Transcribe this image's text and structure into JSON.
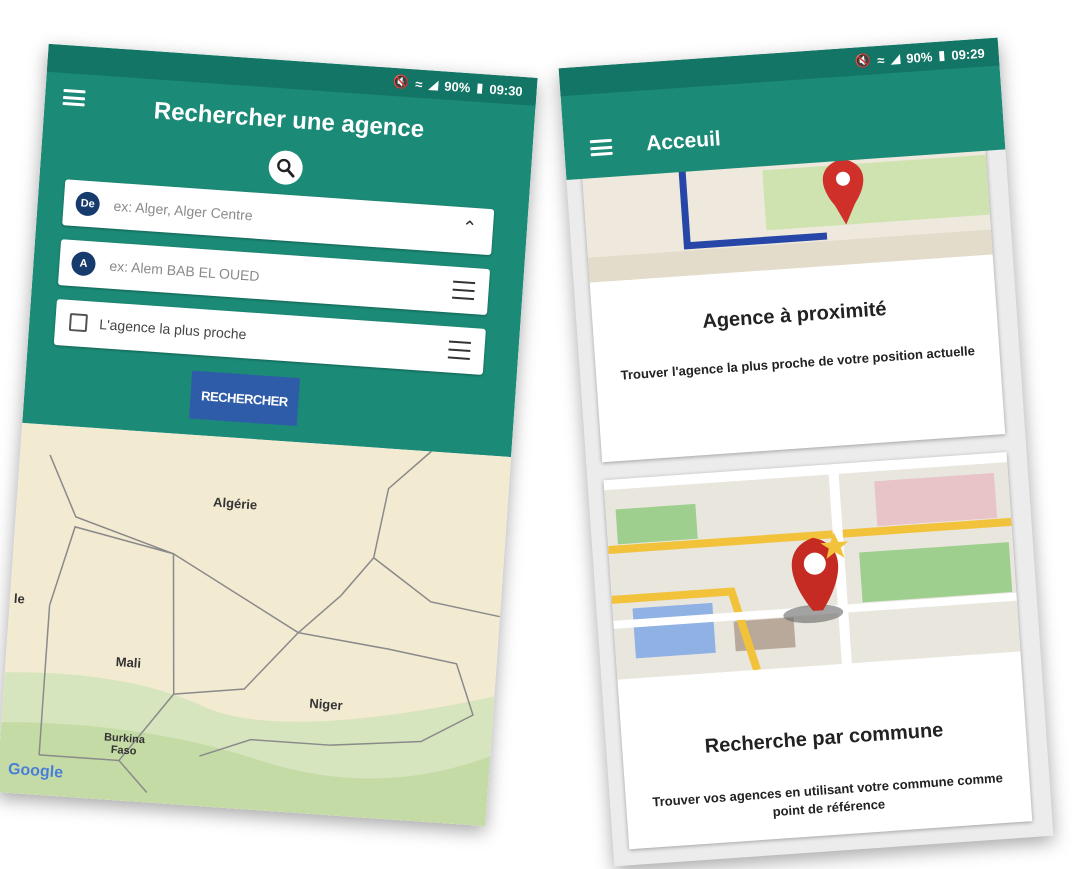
{
  "left_phone": {
    "status": {
      "mute_icon": "mute-icon",
      "wifi_icon": "wifi-icon",
      "signal_icon": "signal-icon",
      "battery": "90%",
      "battery_icon": "battery-icon",
      "time": "09:30"
    },
    "menu_icon": "hamburger-icon",
    "title": "Rechercher une agence",
    "search_icon": "search-icon",
    "from_field": {
      "badge": "De",
      "placeholder": "ex: Alger, Alger Centre",
      "toggle_icon": "chevron-up-icon"
    },
    "to_field": {
      "badge": "A",
      "placeholder": "ex: Alem BAB EL OUED",
      "menu_icon": "list-icon"
    },
    "nearest": {
      "label": "L'agence la plus proche",
      "checked": false,
      "menu_icon": "list-icon"
    },
    "search_button": "RECHERCHER",
    "map": {
      "labels": [
        "Algérie",
        "Mali",
        "Niger",
        "Burkina Faso",
        "le"
      ],
      "logo": "Google"
    },
    "colors": {
      "primary": "#1b8a76",
      "status_bar": "#137565",
      "button": "#2f5ca8",
      "badge": "#183b6d"
    }
  },
  "right_phone": {
    "status": {
      "mute_icon": "mute-icon",
      "wifi_icon": "wifi-icon",
      "signal_icon": "signal-icon",
      "battery": "90%",
      "battery_icon": "battery-icon",
      "time": "09:29"
    },
    "menu_icon": "hamburger-icon",
    "title": "Acceuil",
    "cards": [
      {
        "illustration": "map-pin-route-illustration",
        "title": "Agence à proximité",
        "description": "Trouver l'agence la plus proche de votre position actuelle"
      },
      {
        "illustration": "map-pin-star-illustration",
        "title": "Recherche par commune",
        "description": "Trouver vos agences en utilisant votre commune comme point de réfé​rence"
      }
    ]
  }
}
